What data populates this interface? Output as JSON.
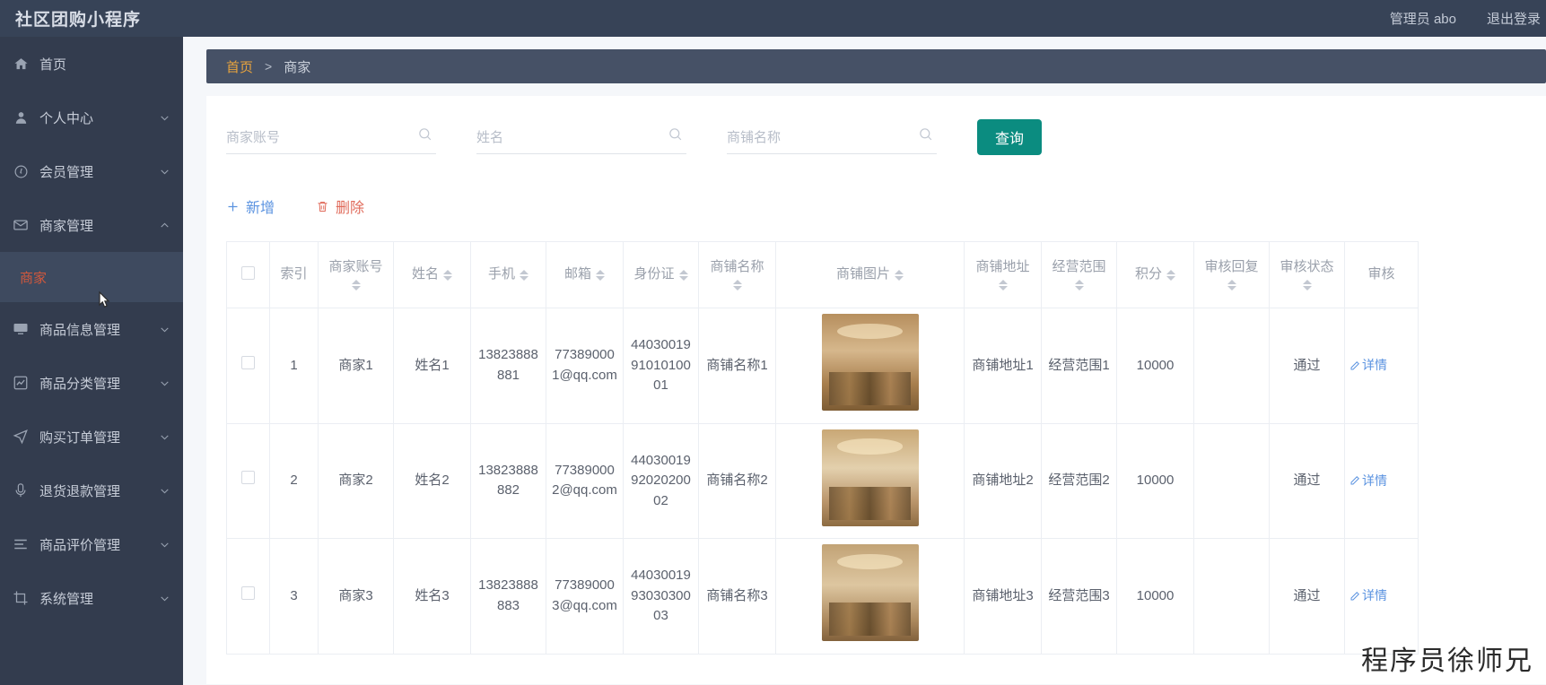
{
  "header": {
    "brand": "社区团购小程序",
    "user_label": "管理员 abo",
    "logout_label": "退出登录"
  },
  "sidebar": {
    "items": [
      {
        "label": "首页",
        "icon": "home-icon",
        "expandable": false,
        "expanded": false
      },
      {
        "label": "个人中心",
        "icon": "user-icon",
        "expandable": true,
        "expanded": false
      },
      {
        "label": "会员管理",
        "icon": "compass-icon",
        "expandable": true,
        "expanded": false
      },
      {
        "label": "商家管理",
        "icon": "mail-icon",
        "expandable": true,
        "expanded": true
      },
      {
        "label": "商品信息管理",
        "icon": "monitor-icon",
        "expandable": true,
        "expanded": false
      },
      {
        "label": "商品分类管理",
        "icon": "chart-icon",
        "expandable": true,
        "expanded": false
      },
      {
        "label": "购买订单管理",
        "icon": "send-icon",
        "expandable": true,
        "expanded": false
      },
      {
        "label": "退货退款管理",
        "icon": "microphone-icon",
        "expandable": true,
        "expanded": false
      },
      {
        "label": "商品评价管理",
        "icon": "list-icon",
        "expandable": true,
        "expanded": false
      },
      {
        "label": "系统管理",
        "icon": "crop-icon",
        "expandable": true,
        "expanded": false
      }
    ],
    "active_submenu": "商家"
  },
  "breadcrumb": {
    "home": "首页",
    "separator": ">",
    "current": "商家"
  },
  "search": {
    "fields": [
      {
        "placeholder": "商家账号",
        "value": ""
      },
      {
        "placeholder": "姓名",
        "value": ""
      },
      {
        "placeholder": "商铺名称",
        "value": ""
      }
    ],
    "query_label": "查询"
  },
  "toolbar": {
    "add_label": "新增",
    "delete_label": "删除"
  },
  "table": {
    "columns": [
      {
        "label": "",
        "sortable": false,
        "key": "check"
      },
      {
        "label": "索引",
        "sortable": false,
        "key": "index"
      },
      {
        "label": "商家账号",
        "sortable": true,
        "key": "account"
      },
      {
        "label": "姓名",
        "sortable": true,
        "key": "name"
      },
      {
        "label": "手机",
        "sortable": true,
        "key": "phone"
      },
      {
        "label": "邮箱",
        "sortable": true,
        "key": "email"
      },
      {
        "label": "身份证",
        "sortable": true,
        "key": "idcard"
      },
      {
        "label": "商铺名称",
        "sortable": true,
        "key": "shop_name"
      },
      {
        "label": "商铺图片",
        "sortable": true,
        "key": "shop_image"
      },
      {
        "label": "商铺地址",
        "sortable": true,
        "key": "shop_address"
      },
      {
        "label": "经营范围",
        "sortable": true,
        "key": "business_scope"
      },
      {
        "label": "积分",
        "sortable": true,
        "key": "points"
      },
      {
        "label": "审核回复",
        "sortable": true,
        "key": "audit_reply"
      },
      {
        "label": "审核状态",
        "sortable": true,
        "key": "audit_status"
      },
      {
        "label": "审核",
        "sortable": false,
        "key": "audit_action"
      }
    ],
    "rows": [
      {
        "index": "1",
        "account": "商家1",
        "name": "姓名1",
        "phone": "13823888881",
        "email": "773890001@qq.com",
        "idcard": "440300199101010001",
        "shop_name": "商铺名称1",
        "shop_image": "shop-photo-1",
        "shop_address": "商铺地址1",
        "business_scope": "经营范围1",
        "points": "10000",
        "audit_reply": "",
        "audit_status": "通过",
        "audit_action": "详情"
      },
      {
        "index": "2",
        "account": "商家2",
        "name": "姓名2",
        "phone": "13823888882",
        "email": "773890002@qq.com",
        "idcard": "440300199202020002",
        "shop_name": "商铺名称2",
        "shop_image": "shop-photo-2",
        "shop_address": "商铺地址2",
        "business_scope": "经营范围2",
        "points": "10000",
        "audit_reply": "",
        "audit_status": "通过",
        "audit_action": "详情"
      },
      {
        "index": "3",
        "account": "商家3",
        "name": "姓名3",
        "phone": "13823888883",
        "email": "773890003@qq.com",
        "idcard": "440300199303030003",
        "shop_name": "商铺名称3",
        "shop_image": "shop-photo-3",
        "shop_address": "商铺地址3",
        "business_scope": "经营范围3",
        "points": "10000",
        "audit_reply": "",
        "audit_status": "通过",
        "audit_action": "详情"
      }
    ]
  },
  "watermark": "程序员徐师兄",
  "colors": {
    "header_bg": "#374357",
    "sidebar_bg": "#333c4e",
    "submenu_active_bg": "#3e4a5f",
    "submenu_active_text": "#d2583c",
    "breadcrumb_bg": "#465166",
    "breadcrumb_home": "#e8a33d",
    "query_button": "#0b8c80",
    "add_link": "#5b93e0",
    "delete_link": "#e06a5a"
  }
}
